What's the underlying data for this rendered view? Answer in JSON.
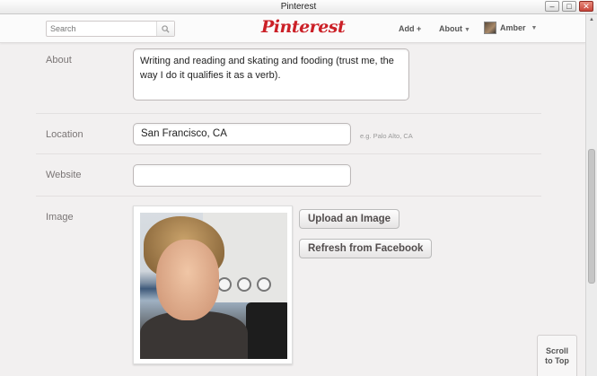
{
  "window": {
    "title": "Pinterest"
  },
  "header": {
    "search_placeholder": "Search",
    "logo": "Pinterest",
    "nav": {
      "add": "Add +",
      "about": "About",
      "user": "Amber"
    }
  },
  "form": {
    "about": {
      "label": "About",
      "value": "Writing and reading and skating and fooding (trust me, the way I do it qualifies it as a verb)."
    },
    "location": {
      "label": "Location",
      "value": "San Francisco, CA",
      "hint": "e.g. Palo Alto, CA"
    },
    "website": {
      "label": "Website",
      "value": ""
    },
    "image": {
      "label": "Image",
      "upload_label": "Upload an Image",
      "refresh_label": "Refresh from Facebook"
    }
  },
  "scroll_top": {
    "line1": "Scroll",
    "line2": "to Top"
  },
  "colors": {
    "brand": "#cb2027",
    "background": "#f2f0f0"
  }
}
